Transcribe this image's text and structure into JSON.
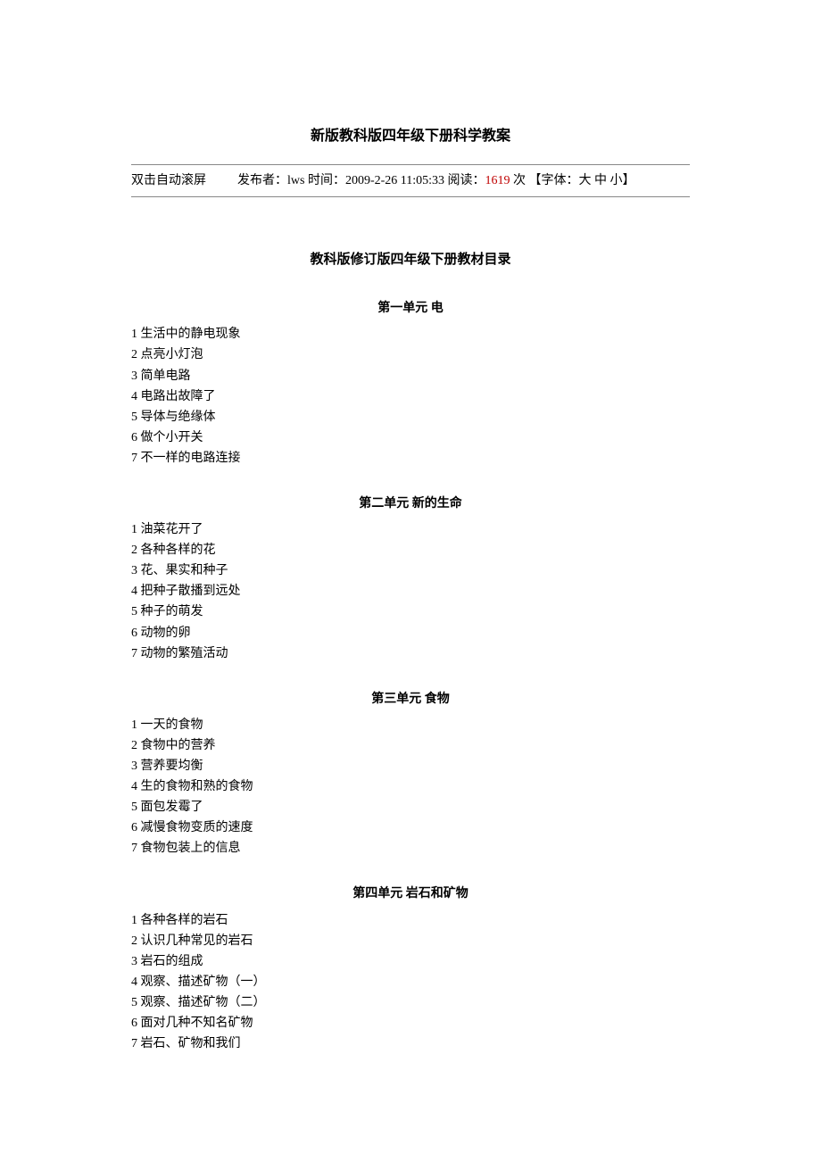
{
  "title": "新版教科版四年级下册科学教案",
  "meta": {
    "auto_scroll": "双击自动滚屏",
    "publisher_label": "发布者：",
    "publisher": "lws",
    "time_label": " 时间：",
    "time": "2009-2-26 11:05:33",
    "read_label": " 阅读：",
    "read_count": "1619",
    "read_suffix": " 次 ",
    "font_label": "【字体：",
    "font_large": "大",
    "font_medium": "中",
    "font_small": "小",
    "font_close": "】"
  },
  "subtitle": "教科版修订版四年级下册教材目录",
  "units": [
    {
      "heading": "第一单元     电",
      "items": [
        "1 生活中的静电现象",
        "2 点亮小灯泡",
        "3 简单电路",
        "4 电路出故障了",
        "5 导体与绝缘体",
        "6 做个小开关",
        "7 不一样的电路连接"
      ]
    },
    {
      "heading": "第二单元    新的生命",
      "items": [
        "1 油菜花开了",
        "2 各种各样的花",
        "3 花、果实和种子",
        "4 把种子散播到远处",
        "5 种子的萌发",
        "6 动物的卵",
        "7 动物的繁殖活动"
      ]
    },
    {
      "heading": "第三单元  食物",
      "items": [
        "1 一天的食物",
        "2 食物中的营养",
        "3 营养要均衡",
        "4 生的食物和熟的食物",
        "5 面包发霉了",
        "6 减慢食物变质的速度",
        "7 食物包装上的信息"
      ]
    },
    {
      "heading": "第四单元  岩石和矿物",
      "items": [
        "1 各种各样的岩石",
        "2 认识几种常见的岩石",
        "3 岩石的组成",
        "4 观察、描述矿物（一）",
        "5 观察、描述矿物（二）",
        "6 面对几种不知名矿物",
        "7 岩石、矿物和我们"
      ]
    }
  ]
}
